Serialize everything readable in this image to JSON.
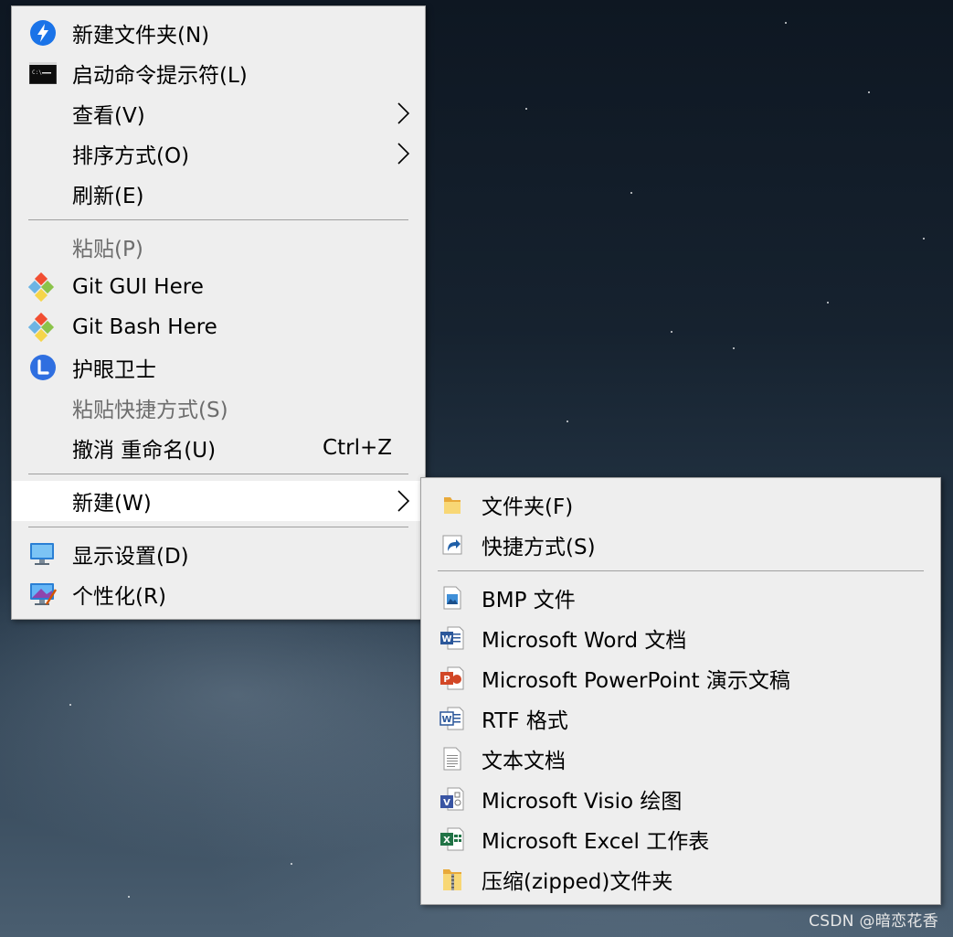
{
  "context_menu": {
    "items": [
      {
        "label": "新建文件夹(N)",
        "icon": "lightning-icon"
      },
      {
        "label": "启动命令提示符(L)",
        "icon": "cmd-icon"
      },
      {
        "label": "查看(V)",
        "submenu": true
      },
      {
        "label": "排序方式(O)",
        "submenu": true
      },
      {
        "label": "刷新(E)"
      },
      {
        "label": "粘贴(P)",
        "disabled": true
      },
      {
        "label": "Git GUI Here",
        "icon": "git-icon"
      },
      {
        "label": "Git Bash Here",
        "icon": "git-icon"
      },
      {
        "label": "护眼卫士",
        "icon": "eye-guard-icon"
      },
      {
        "label": "粘贴快捷方式(S)",
        "disabled": true
      },
      {
        "label": "撤消 重命名(U)",
        "shortcut": "Ctrl+Z"
      },
      {
        "label": "新建(W)",
        "submenu": true,
        "highlighted": true
      },
      {
        "label": "显示设置(D)",
        "icon": "display-icon"
      },
      {
        "label": "个性化(R)",
        "icon": "personalize-icon"
      }
    ]
  },
  "new_submenu": {
    "items": [
      {
        "label": "文件夹(F)",
        "icon": "folder-icon"
      },
      {
        "label": "快捷方式(S)",
        "icon": "shortcut-icon"
      },
      {
        "label": "BMP 文件",
        "icon": "bmp-file-icon"
      },
      {
        "label": "Microsoft Word 文档",
        "icon": "word-icon"
      },
      {
        "label": "Microsoft PowerPoint 演示文稿",
        "icon": "powerpoint-icon"
      },
      {
        "label": "RTF 格式",
        "icon": "rtf-icon"
      },
      {
        "label": "文本文档",
        "icon": "text-document-icon"
      },
      {
        "label": "Microsoft Visio 绘图",
        "icon": "visio-icon"
      },
      {
        "label": "Microsoft Excel 工作表",
        "icon": "excel-icon"
      },
      {
        "label": "压缩(zipped)文件夹",
        "icon": "zip-folder-icon"
      }
    ]
  },
  "watermark": "CSDN @暗恋花香",
  "colors": {
    "menu_bg": "#eeeeee",
    "highlight": "#ffffff",
    "disabled_text": "#6d6d6d",
    "separator": "#a0a0a0"
  }
}
